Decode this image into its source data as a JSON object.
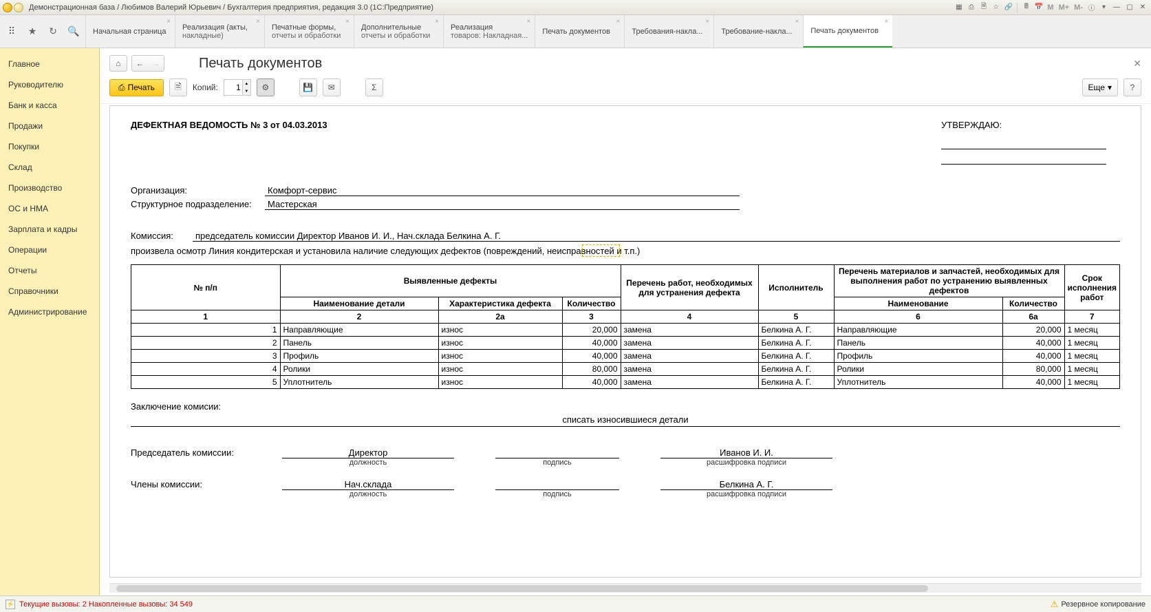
{
  "window_title": "Демонстрационная база / Любимов Валерий Юрьевич / Бухгалтерия предприятия, редакция 3.0  (1С:Предприятие)",
  "mem_buttons": [
    "M",
    "M+",
    "M-"
  ],
  "tabs": [
    {
      "l1": "Начальная страница"
    },
    {
      "l1": "Реализация (акты,",
      "l2": "накладные)"
    },
    {
      "l1": "Печатные формы,",
      "l2": "отчеты и обработки"
    },
    {
      "l1": "Дополнительные",
      "l2": "отчеты и обработки"
    },
    {
      "l1": "Реализация",
      "l2": "товаров: Накладная..."
    },
    {
      "l1": "Печать документов"
    },
    {
      "l1": "Требования-накла..."
    },
    {
      "l1": "Требование-накла..."
    },
    {
      "l1": "Печать документов",
      "active": true
    }
  ],
  "sidebar": [
    "Главное",
    "Руководителю",
    "Банк и касса",
    "Продажи",
    "Покупки",
    "Склад",
    "Производство",
    "ОС и НМА",
    "Зарплата и кадры",
    "Операции",
    "Отчеты",
    "Справочники",
    "Администрирование"
  ],
  "page_title": "Печать документов",
  "toolbar": {
    "print": "Печать",
    "copies_label": "Копий:",
    "copies_value": "1",
    "more": "Еще"
  },
  "doc": {
    "title": "ДЕФЕКТНАЯ ВЕДОМОСТЬ № 3 от 04.03.2013",
    "approve": "УТВЕРЖДАЮ:",
    "org_label": "Организация:",
    "org_value": "Комфорт-сервис",
    "dep_label": "Структурное подразделение:",
    "dep_value": "Мастерская",
    "comm_label": "Комиссия:",
    "comm_value": "председатель комиссии Директор Иванов И. И., Нач.склада Белкина А. Г.",
    "examined": "произвела осмотр Линия кондитерская и установила наличие следующих дефектов (повреждений, неисправностей и т.п.)",
    "headers": {
      "num": "№ п/п",
      "defects": "Выявленные дефекты",
      "detail": "Наименование детали",
      "char": "Характеристика дефекта",
      "qty": "Количество",
      "works": "Перечень работ, необходимых для устранения дефекта",
      "exec": "Исполнитель",
      "materials": "Перечень материалов и запчастей, необходимых для выполнения работ по устранению выявленных дефектов",
      "mat_name": "Наименование",
      "mat_qty": "Количество",
      "deadline": "Срок исполнения работ",
      "idx": [
        "1",
        "2",
        "2а",
        "3",
        "4",
        "5",
        "6",
        "6а",
        "7"
      ]
    },
    "rows": [
      {
        "n": "1",
        "detail": "Направляющие",
        "char": "износ",
        "qty": "20,000",
        "work": "замена",
        "exec": "Белкина А. Г.",
        "mat": "Направляющие",
        "mqty": "20,000",
        "due": "1 месяц"
      },
      {
        "n": "2",
        "detail": "Панель",
        "char": "износ",
        "qty": "40,000",
        "work": "замена",
        "exec": "Белкина А. Г.",
        "mat": "Панель",
        "mqty": "40,000",
        "due": "1 месяц"
      },
      {
        "n": "3",
        "detail": "Профиль",
        "char": "износ",
        "qty": "40,000",
        "work": "замена",
        "exec": "Белкина А. Г.",
        "mat": "Профиль",
        "mqty": "40,000",
        "due": "1 месяц"
      },
      {
        "n": "4",
        "detail": "Ролики",
        "char": "износ",
        "qty": "80,000",
        "work": "замена",
        "exec": "Белкина А. Г.",
        "mat": "Ролики",
        "mqty": "80,000",
        "due": "1 месяц"
      },
      {
        "n": "5",
        "detail": "Уплотнитель",
        "char": "износ",
        "qty": "40,000",
        "work": "замена",
        "exec": "Белкина А. Г.",
        "mat": "Уплотнитель",
        "mqty": "40,000",
        "due": "1 месяц"
      }
    ],
    "conclusion_label": "Заключение комисии:",
    "conclusion_value": "списать износившиеся детали",
    "chairman_label": "Председатель комиссии:",
    "members_label": "Члены комиссии:",
    "sig_caps": {
      "pos": "должность",
      "sign": "подпись",
      "dec": "расшифровка подписи"
    },
    "chairman": {
      "pos": "Директор",
      "name": "Иванов И. И."
    },
    "member": {
      "pos": "Нач.склада",
      "name": "Белкина А. Г."
    }
  },
  "status": {
    "cur_label": "Текущие вызовы: ",
    "cur_val": "2",
    "acc_label": "  Накопленные вызовы: ",
    "acc_val": "34 549",
    "backup": "Резервное копирование"
  }
}
